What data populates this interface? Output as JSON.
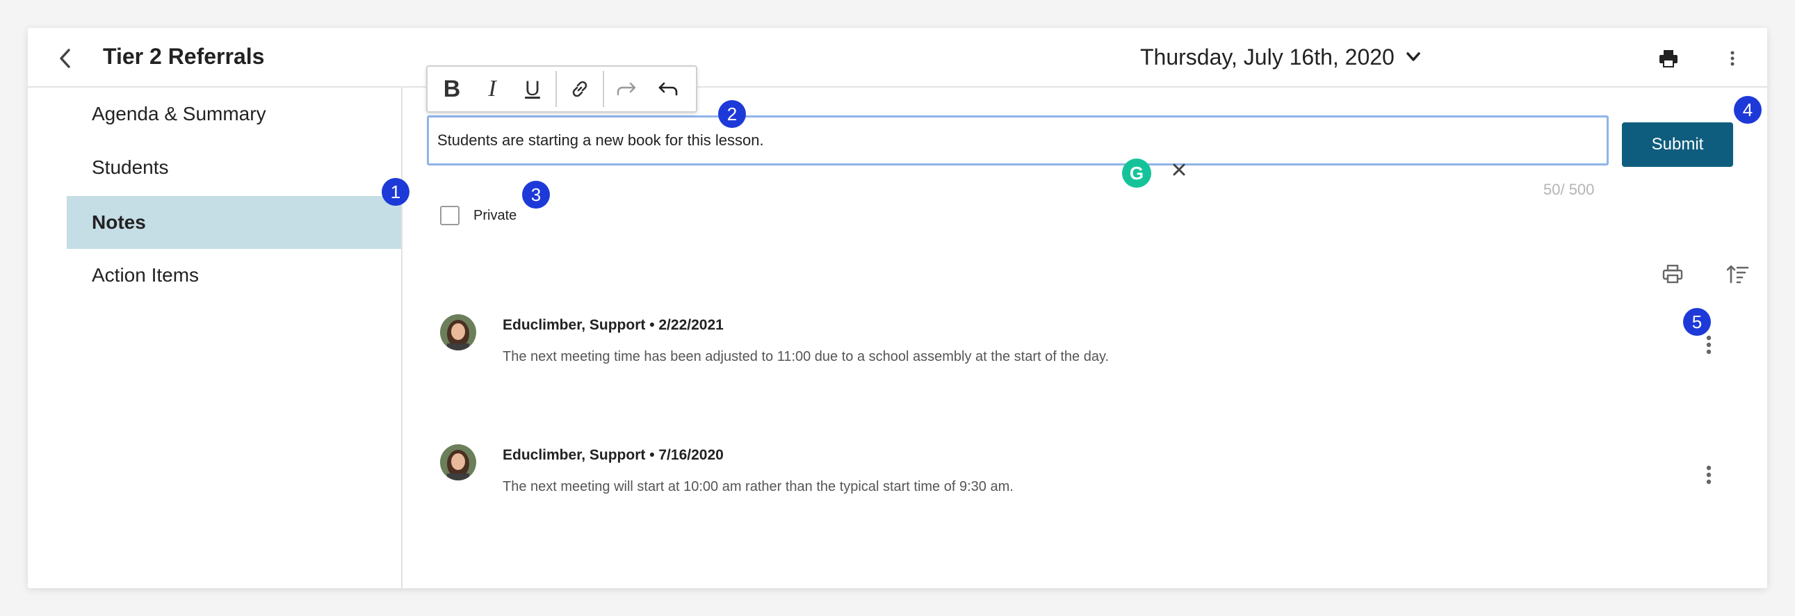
{
  "header": {
    "title": "Tier 2 Referrals",
    "date": "Thursday, July 16th, 2020"
  },
  "sidebar": {
    "items": [
      {
        "label": "Agenda & Summary",
        "active": false
      },
      {
        "label": "Students",
        "active": false
      },
      {
        "label": "Notes",
        "active": true
      },
      {
        "label": "Action Items",
        "active": false
      }
    ]
  },
  "editor": {
    "toolbar": [
      "bold",
      "italic",
      "underline",
      "link-icon",
      "redo-icon",
      "undo-icon"
    ],
    "bold_glyph": "B",
    "italic_glyph": "I",
    "underline_glyph": "U",
    "value": "Students are starting a new book for this lesson.",
    "counter": "50/ 500",
    "submit_label": "Submit",
    "private_label": "Private",
    "grammarly_glyph": "G"
  },
  "notes": [
    {
      "author": "Educlimber, Support • 2/22/2021",
      "body": "The next meeting time has been adjusted to 11:00 due to a school assembly at the start of the day."
    },
    {
      "author": "Educlimber, Support • 7/16/2020",
      "body": "The next meeting will start at 10:00 am rather than the typical start time of 9:30 am."
    }
  ],
  "badges": [
    "1",
    "2",
    "3",
    "4",
    "5"
  ],
  "colors": {
    "accent": "#0f5d7e",
    "active_nav": "#c5dde5",
    "badge": "#1d3ad8",
    "grammarly": "#15c39a"
  }
}
